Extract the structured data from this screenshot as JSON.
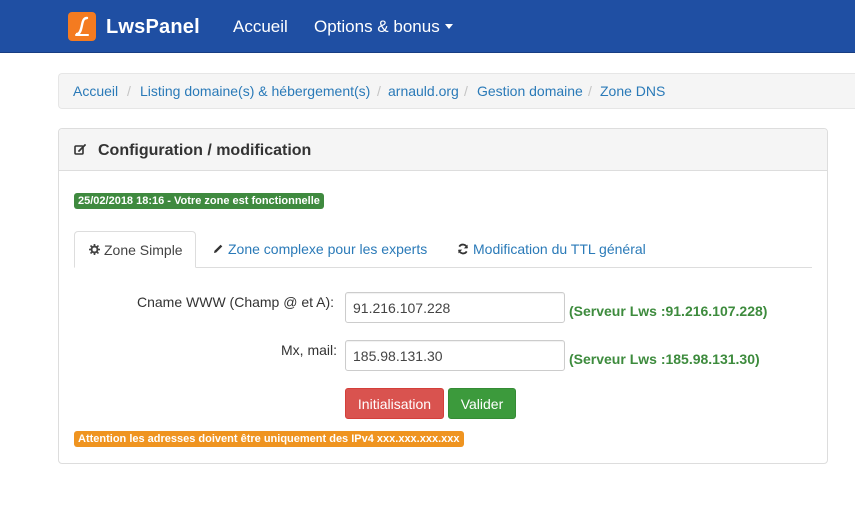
{
  "navbar": {
    "brand": "LwsPanel",
    "items": [
      {
        "label": "Accueil"
      },
      {
        "label": "Options & bonus"
      }
    ]
  },
  "breadcrumb": {
    "items": [
      "Accueil",
      "Listing domaine(s) & hébergement(s)",
      "arnauld.org",
      "Gestion domaine",
      "Zone DNS"
    ],
    "separator": "/"
  },
  "panel": {
    "title": "Configuration / modification",
    "status": "25/02/2018 18:16 - Votre zone est fonctionnelle",
    "tabs": [
      {
        "label": "Zone Simple",
        "icon": "gear-icon",
        "active": true
      },
      {
        "label": "Zone complexe pour les experts",
        "icon": "pencil-icon",
        "active": false
      },
      {
        "label": "Modification du TTL général",
        "icon": "refresh-icon",
        "active": false
      }
    ],
    "form": {
      "cname": {
        "label": "Cname WWW (Champ @ et A):",
        "value": "91.216.107.228",
        "hint": "(Serveur Lws :91.216.107.228)"
      },
      "mx": {
        "label": "Mx, mail:",
        "value": "185.98.131.30",
        "hint": "(Serveur Lws :185.98.131.30)"
      }
    },
    "buttons": {
      "init": "Initialisation",
      "validate": "Valider"
    },
    "warning": "Attention les adresses doivent être uniquement des IPv4 xxx.xxx.xxx.xxx"
  },
  "colors": {
    "navbar": "#1f4fa3",
    "logo": "#f47b20",
    "link": "#2a7ab8",
    "success": "#3f8a3f",
    "danger": "#d9534f",
    "warning": "#ef9420"
  }
}
